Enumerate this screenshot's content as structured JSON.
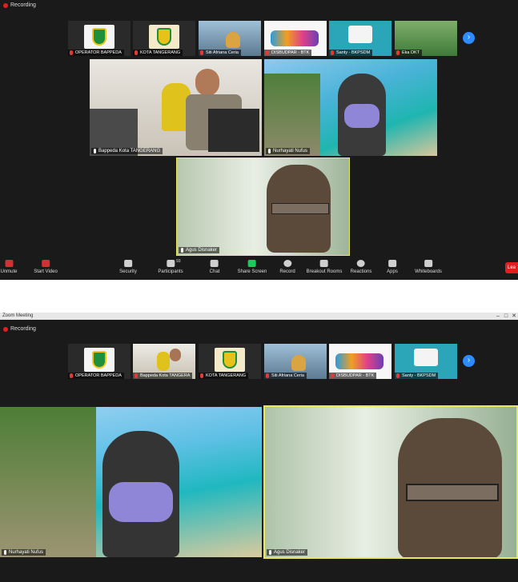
{
  "top": {
    "recording_label": "Recording",
    "thumbnails": [
      {
        "name": "OPERATOR BAPPEDA"
      },
      {
        "name": "KOTA TANGERANG"
      },
      {
        "name": "Siti Afriana Ceria"
      },
      {
        "name": "DISBUDPAR - BTK"
      },
      {
        "name": "Santy - BKPSDM"
      },
      {
        "name": "Eka DKT"
      }
    ],
    "tiles": [
      {
        "name": "Bappeda Kota TANGERANG"
      },
      {
        "name": "Nurhayati Nufus"
      },
      {
        "name": "Agus Disnaker"
      }
    ],
    "toolbar": {
      "unmute": "Unmute",
      "start_video": "Start Video",
      "security": "Security",
      "participants": "Participants",
      "participants_count": "93",
      "chat": "Chat",
      "share_screen": "Share Screen",
      "record": "Record",
      "breakout_rooms": "Breakout Rooms",
      "reactions": "Reactions",
      "apps": "Apps",
      "whiteboards": "Whiteboards",
      "leave": "Lea"
    },
    "next_icon": "›"
  },
  "bottom": {
    "window_title": "Zoom Meeting",
    "recording_label": "Recording",
    "thumbnails": [
      {
        "name": "OPERATOR BAPPEDA"
      },
      {
        "name": "Bappeda Kota TANGERA"
      },
      {
        "name": "KOTA TANGERANG"
      },
      {
        "name": "Siti Afriana Ceria"
      },
      {
        "name": "DISBUDPAR - BTK"
      },
      {
        "name": "Santy - BKPSDM"
      }
    ],
    "tiles": [
      {
        "name": "Nurhayati Nufus"
      },
      {
        "name": "Agus Disnaker"
      }
    ],
    "next_icon": "›"
  },
  "colors": {
    "accent": "#2d8cff",
    "active_speaker": "#e8e85a",
    "recording": "#e02020",
    "share": "#22c55e"
  }
}
